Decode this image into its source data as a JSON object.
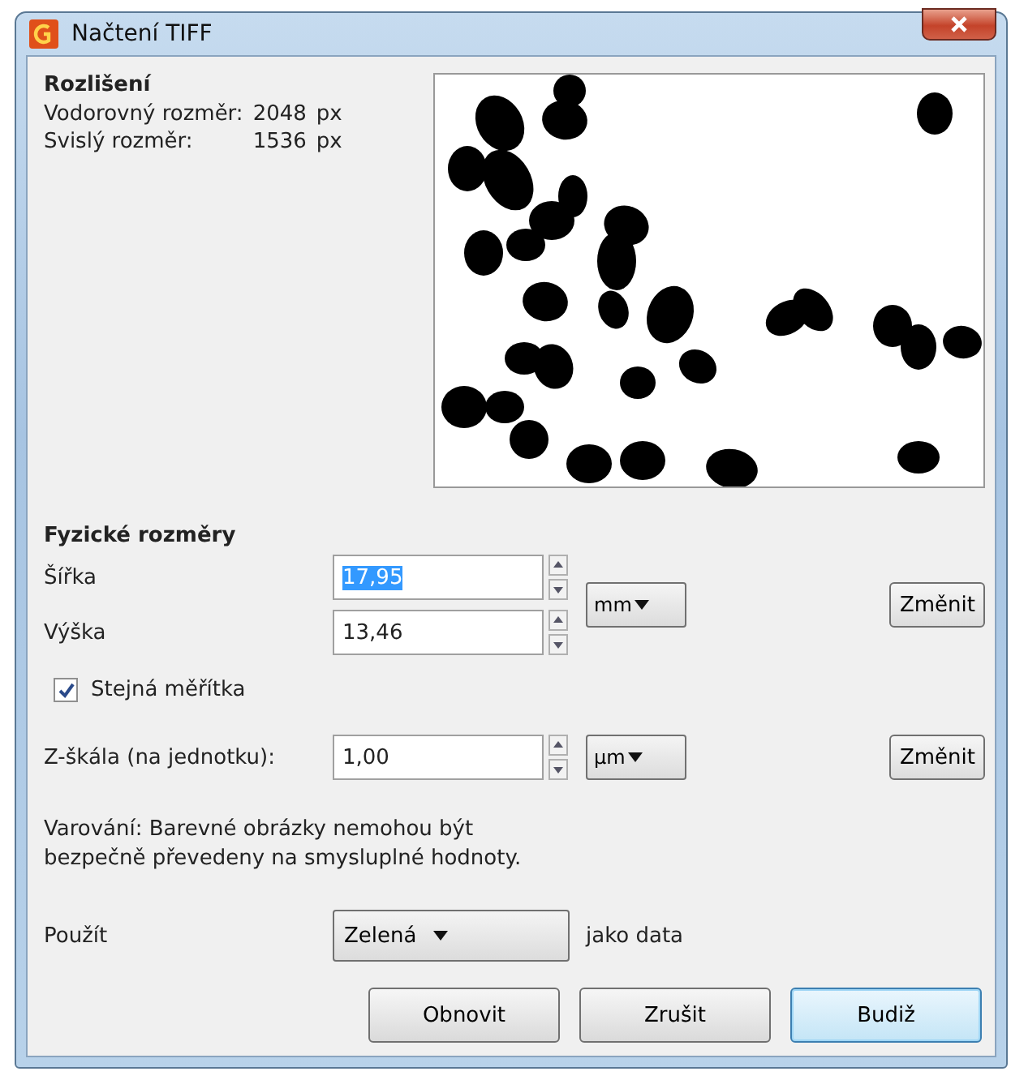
{
  "window": {
    "title": "Načtení TIFF"
  },
  "resolution": {
    "heading": "Rozlišení",
    "rows": [
      {
        "label": "Vodorovný rozměr:",
        "value": "2048",
        "unit": "px"
      },
      {
        "label": "Svislý rozměr:",
        "value": "1536",
        "unit": "px"
      }
    ]
  },
  "physical": {
    "heading": "Fyzické rozměry",
    "fields": [
      {
        "label": "Šířka",
        "value": "17,95",
        "selected": true
      },
      {
        "label": "Výška",
        "value": "13,46",
        "selected": false
      }
    ],
    "unit": "mm",
    "change_button": "Změnit",
    "same_scale": {
      "label": "Stejná měřítka",
      "checked": true
    }
  },
  "z_scale": {
    "label": "Z-škála (na jednotku):",
    "value": "1,00",
    "unit": "µm",
    "change_button": "Změnit"
  },
  "warning": "Varování: Barevné obrázky nemohou být bezpečně převedeny na smysluplné hodnoty.",
  "use": {
    "label": "Použít",
    "value": "Zelená",
    "suffix": "jako data"
  },
  "buttons": [
    {
      "label": "Obnovit",
      "default": false
    },
    {
      "label": "Zrušit",
      "default": false
    },
    {
      "label": "Budiž",
      "default": true
    }
  ]
}
